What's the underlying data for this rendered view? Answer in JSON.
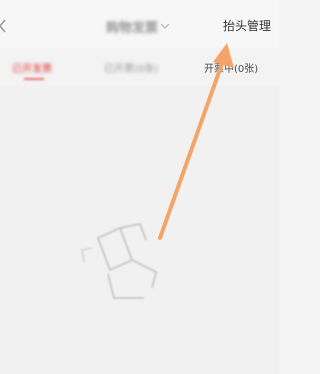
{
  "header": {
    "title": "购物发票",
    "action_label": "抬头管理"
  },
  "tabs": [
    {
      "label": "已开发票"
    },
    {
      "label": "已开票(0张)"
    },
    {
      "label": "开票中(0张)"
    }
  ],
  "colors": {
    "active_tab": "#e23b3b",
    "annotation_arrow": "#f4a466"
  },
  "icons": {
    "back": "chevron-left-icon",
    "title_dropdown": "chevron-down-icon",
    "empty_state": "empty-invoice-illustration"
  }
}
